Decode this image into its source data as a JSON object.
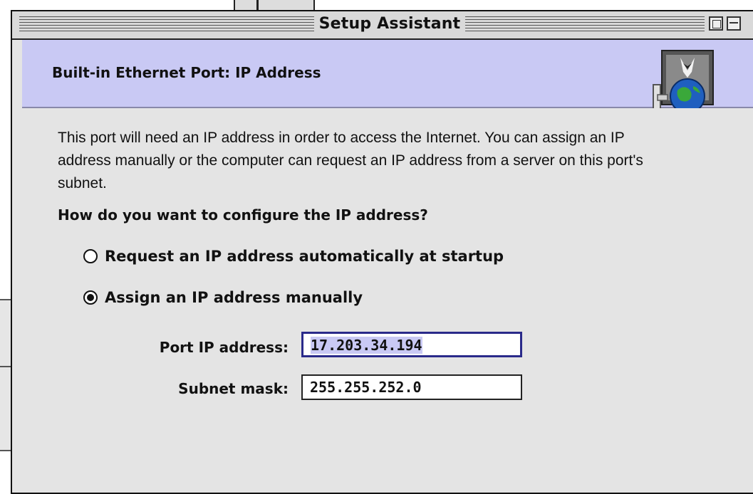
{
  "window": {
    "title": "Setup Assistant"
  },
  "header": {
    "title": "Built-in Ethernet Port:  IP Address"
  },
  "content": {
    "intro": "This port will need an IP address in order to access the Internet.  You can assign an IP address manually or the computer can request an IP address from a server on this port's subnet.",
    "question": "How do you want to configure the IP address?",
    "options": [
      {
        "label": "Request an IP address automatically at startup",
        "selected": false
      },
      {
        "label": "Assign an IP address manually",
        "selected": true
      }
    ],
    "fields": {
      "ip_label": "Port IP address:",
      "ip_value": "17.203.34.194",
      "mask_label": "Subnet mask:",
      "mask_value": "255.255.252.0"
    }
  },
  "colors": {
    "header_band": "#c9c9f4",
    "window_bg": "#e4e4e4",
    "focus_border": "#2a2a8a"
  },
  "icons": [
    "setup-assistant-icon",
    "radio-unchecked",
    "radio-checked",
    "collapse-box-icon",
    "zoom-box-icon"
  ]
}
